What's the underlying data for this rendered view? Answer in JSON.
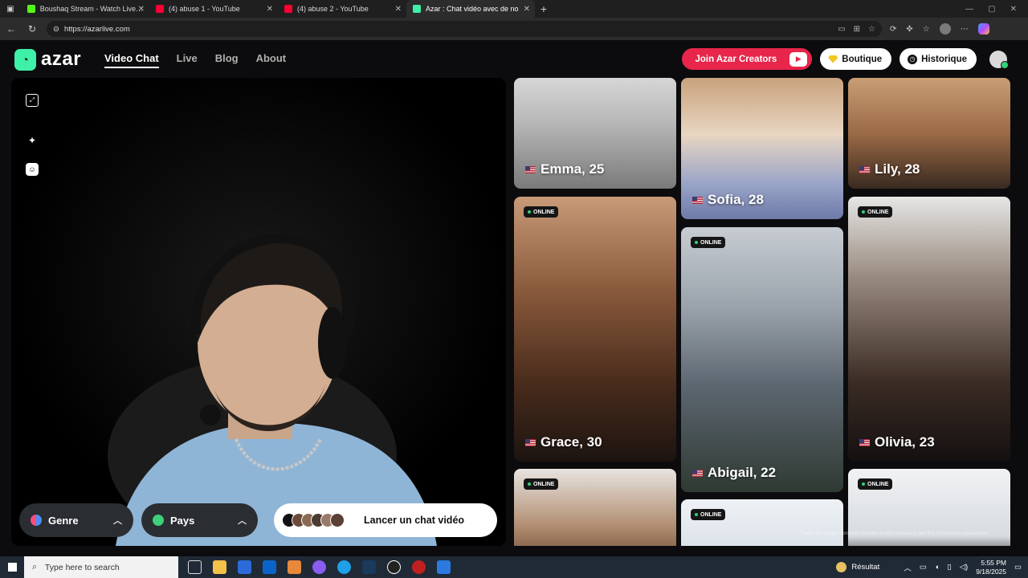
{
  "browser": {
    "tabs": [
      {
        "title": "Boushaq Stream - Watch Live on",
        "color": "#53fc18",
        "active": false
      },
      {
        "title": "(4) abuse 1 - YouTube",
        "color": "#ff0033",
        "active": false
      },
      {
        "title": "(4) abuse 2 - YouTube",
        "color": "#ff0033",
        "active": false
      },
      {
        "title": "Azar : Chat vidéo avec de no",
        "color": "#3ef0a8",
        "active": true
      }
    ],
    "new_tab": "+",
    "url": "https://azarlive.com"
  },
  "site": {
    "logo_text": "azar",
    "nav": [
      "Video Chat",
      "Live",
      "Blog",
      "About"
    ],
    "creators_label": "Join Azar Creators",
    "boutique_label": "Boutique",
    "history_label": "Historique",
    "accent": "#e8254a",
    "brand": "#3ef0a8"
  },
  "video": {
    "genre_label": "Genre",
    "country_label": "Pays",
    "launch_label": "Lancer un chat vidéo"
  },
  "profiles": [
    {
      "name": "Emma, 25",
      "online": false,
      "bg": "linear-gradient(180deg,#d6d6d6 0%,#b8b8b8 40%,#7a7a7a 100%)"
    },
    {
      "name": "Sofia, 28",
      "online": false,
      "bg": "linear-gradient(180deg,#c9a27c 0%,#e8d6c2 40%,#9aa4c8 75%,#6e7aa8 100%)"
    },
    {
      "name": "Lily, 28",
      "online": false,
      "bg": "linear-gradient(180deg,#c89e74 0%,#9b6a46 50%,#3a2a20 100%)"
    },
    {
      "name": "Grace, 30",
      "online": true,
      "online_label": "ONLINE",
      "bg": "linear-gradient(180deg,#c89a78 0%,#8a5a3c 35%,#4a2c1c 70%,#1c1410 100%)"
    },
    {
      "name": "Abigail, 22",
      "online": true,
      "online_label": "ONLINE",
      "bg": "linear-gradient(180deg,#c7ccd2 0%,#9aa3ac 30%,#5c6670 60%,#2f3a33 100%)"
    },
    {
      "name": "Olivia, 23",
      "online": true,
      "online_label": "ONLINE",
      "bg": "linear-gradient(180deg,#e6e6e6 0%,#9a8b80 30%,#3b2c24 70%,#141010 100%)"
    },
    {
      "name": "",
      "online": true,
      "online_label": "ONLINE",
      "bg": "linear-gradient(180deg,#e8e4e0 0%,#b08c70 60%,#6a4a34 100%)"
    },
    {
      "name": "",
      "online": true,
      "online_label": "ONLINE",
      "bg": "linear-gradient(180deg,#eef2f6 0%,#d0d8e0 100%)"
    },
    {
      "name": "",
      "online": true,
      "online_label": "ONLINE",
      "bg": "linear-gradient(180deg,#f0f2f4 0%,#d8dcdf 70%,#202020 100%)"
    }
  ],
  "disclaimer": "Toutes les images sont des modèles et sont utilisées à des fins d'illustration uniquement",
  "taskbar": {
    "search_placeholder": "Type here to search",
    "weather": "Résultat",
    "time": "5:55 PM",
    "date": "9/18/2025"
  }
}
